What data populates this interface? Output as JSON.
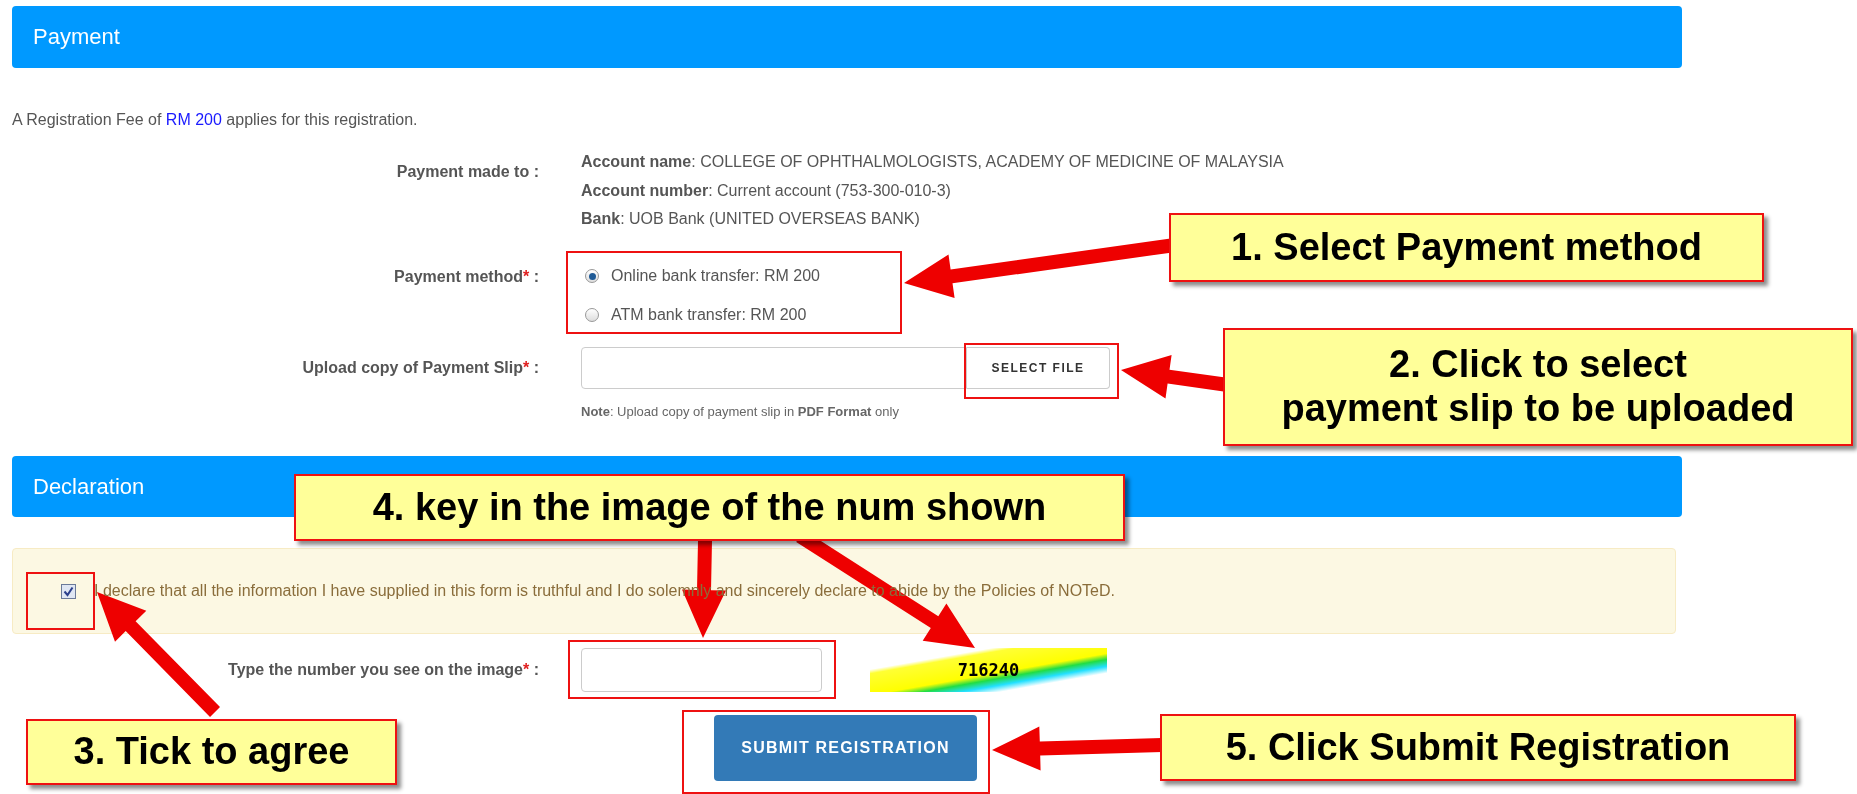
{
  "payment": {
    "title": "Payment",
    "fee_note": {
      "prefix": "A Registration Fee of",
      "amount": "RM 200",
      "suffix": "applies for this registration."
    },
    "payee": {
      "label": "Payment made to :",
      "lines": [
        "**Account name**: COLLEGE OF OPHTHALMOLOGISTS, ACADEMY OF MEDICINE OF MALAYSIA",
        "**Account number**: Current account (753-300-010-3)",
        "**Bank**: UOB Bank (UNITED OVERSEAS BANK)"
      ]
    },
    "method": {
      "label": "Payment method",
      "required": "*",
      "suffix": ":",
      "options": [
        {
          "label": "Online bank transfer: RM 200",
          "selected": true
        },
        {
          "label": "ATM bank transfer: RM 200",
          "selected": false
        }
      ]
    },
    "upload": {
      "label": "Upload copy of Payment Slip",
      "required": "*",
      "suffix": ":",
      "button": "SELECT FILE",
      "note": "**Note**: Upload copy of payment slip in **PDF Format** only"
    }
  },
  "declaration": {
    "title": "Declaration",
    "checked": true,
    "text": "I declare that all the information I have supplied in this form is truthful and I do solemnly and sincerely declare to abide by the Policies of NOTeD.",
    "captcha": {
      "label": "Type the number you see on the image",
      "required": "*",
      "suffix": ":",
      "code": "716240"
    },
    "submit": "SUBMIT REGISTRATION"
  },
  "annotations": [
    {
      "text": "1. Select Payment method"
    },
    {
      "text": "2. Click to select\npayment slip to be uploaded"
    },
    {
      "text": "3. Tick to agree"
    },
    {
      "text": "4. key in the image of the num shown"
    },
    {
      "text": "5. Click Submit Registration"
    }
  ]
}
